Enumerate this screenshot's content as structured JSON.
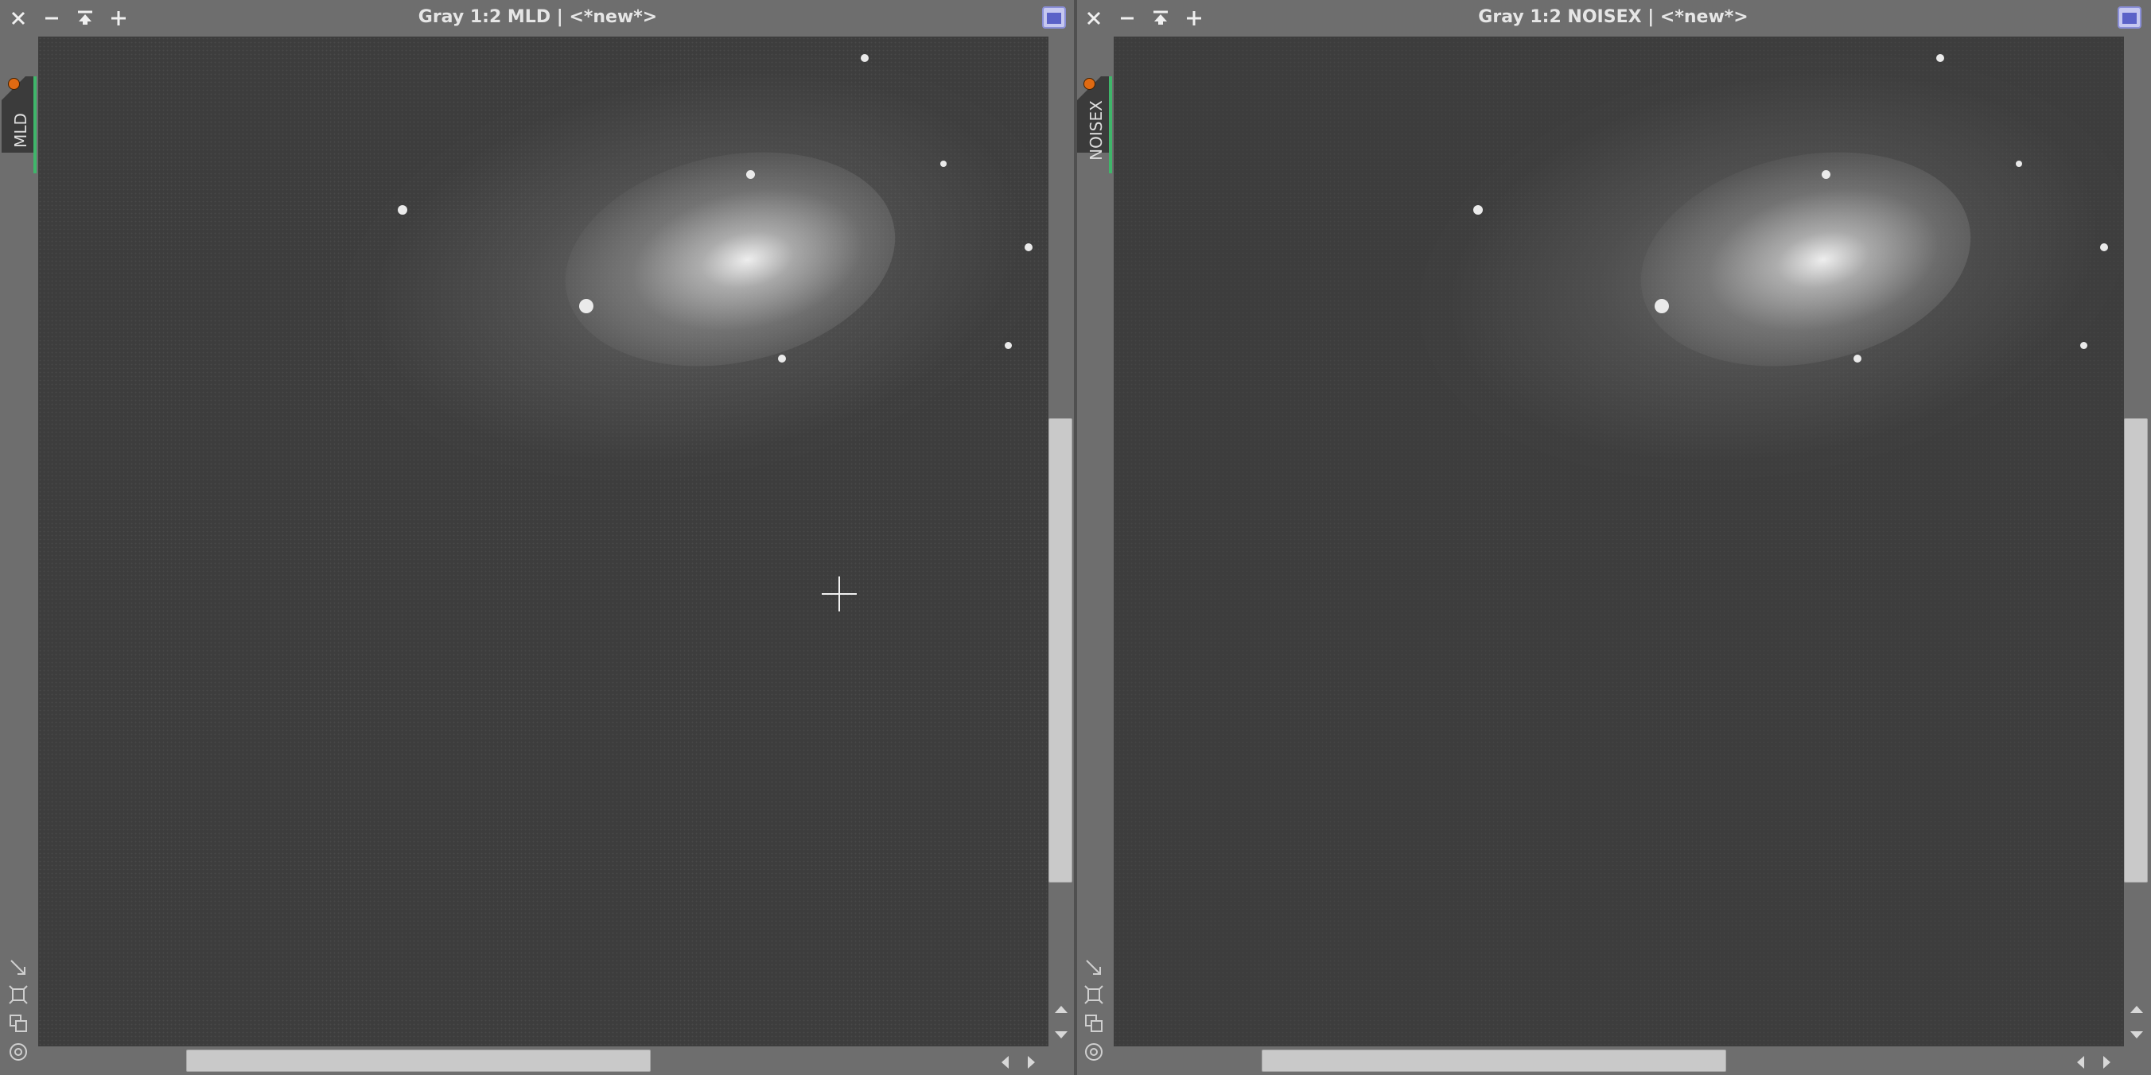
{
  "windows": [
    {
      "title": "Gray 1:2 MLD | <*new*>",
      "identifier": "MLD",
      "shows_cursor": true
    },
    {
      "title": "Gray 1:2 NOISEX | <*new*>",
      "identifier": "NOISEX",
      "shows_cursor": false
    }
  ],
  "colors": {
    "frame": "#6e6e6e",
    "image_background": "#3d3d3d",
    "tab": "#3b3b3b",
    "tab_accent": "#3fb66a",
    "status_dot": "#e06a12",
    "scroll_thumb": "#c9c9c9"
  },
  "scroll": {
    "vertical_position": 0.5,
    "horizontal_position": 0.5
  },
  "icons": {
    "titlebar": [
      "close-icon",
      "minimize-icon",
      "maximize-icon",
      "zoom-in-icon",
      "shade-icon"
    ],
    "sidebar": [
      "resize-icon",
      "fit-view-icon",
      "clone-icon",
      "target-icon"
    ],
    "scrollbar": [
      "scroll-up-icon",
      "scroll-down-icon",
      "scroll-left-icon",
      "scroll-right-icon"
    ]
  }
}
